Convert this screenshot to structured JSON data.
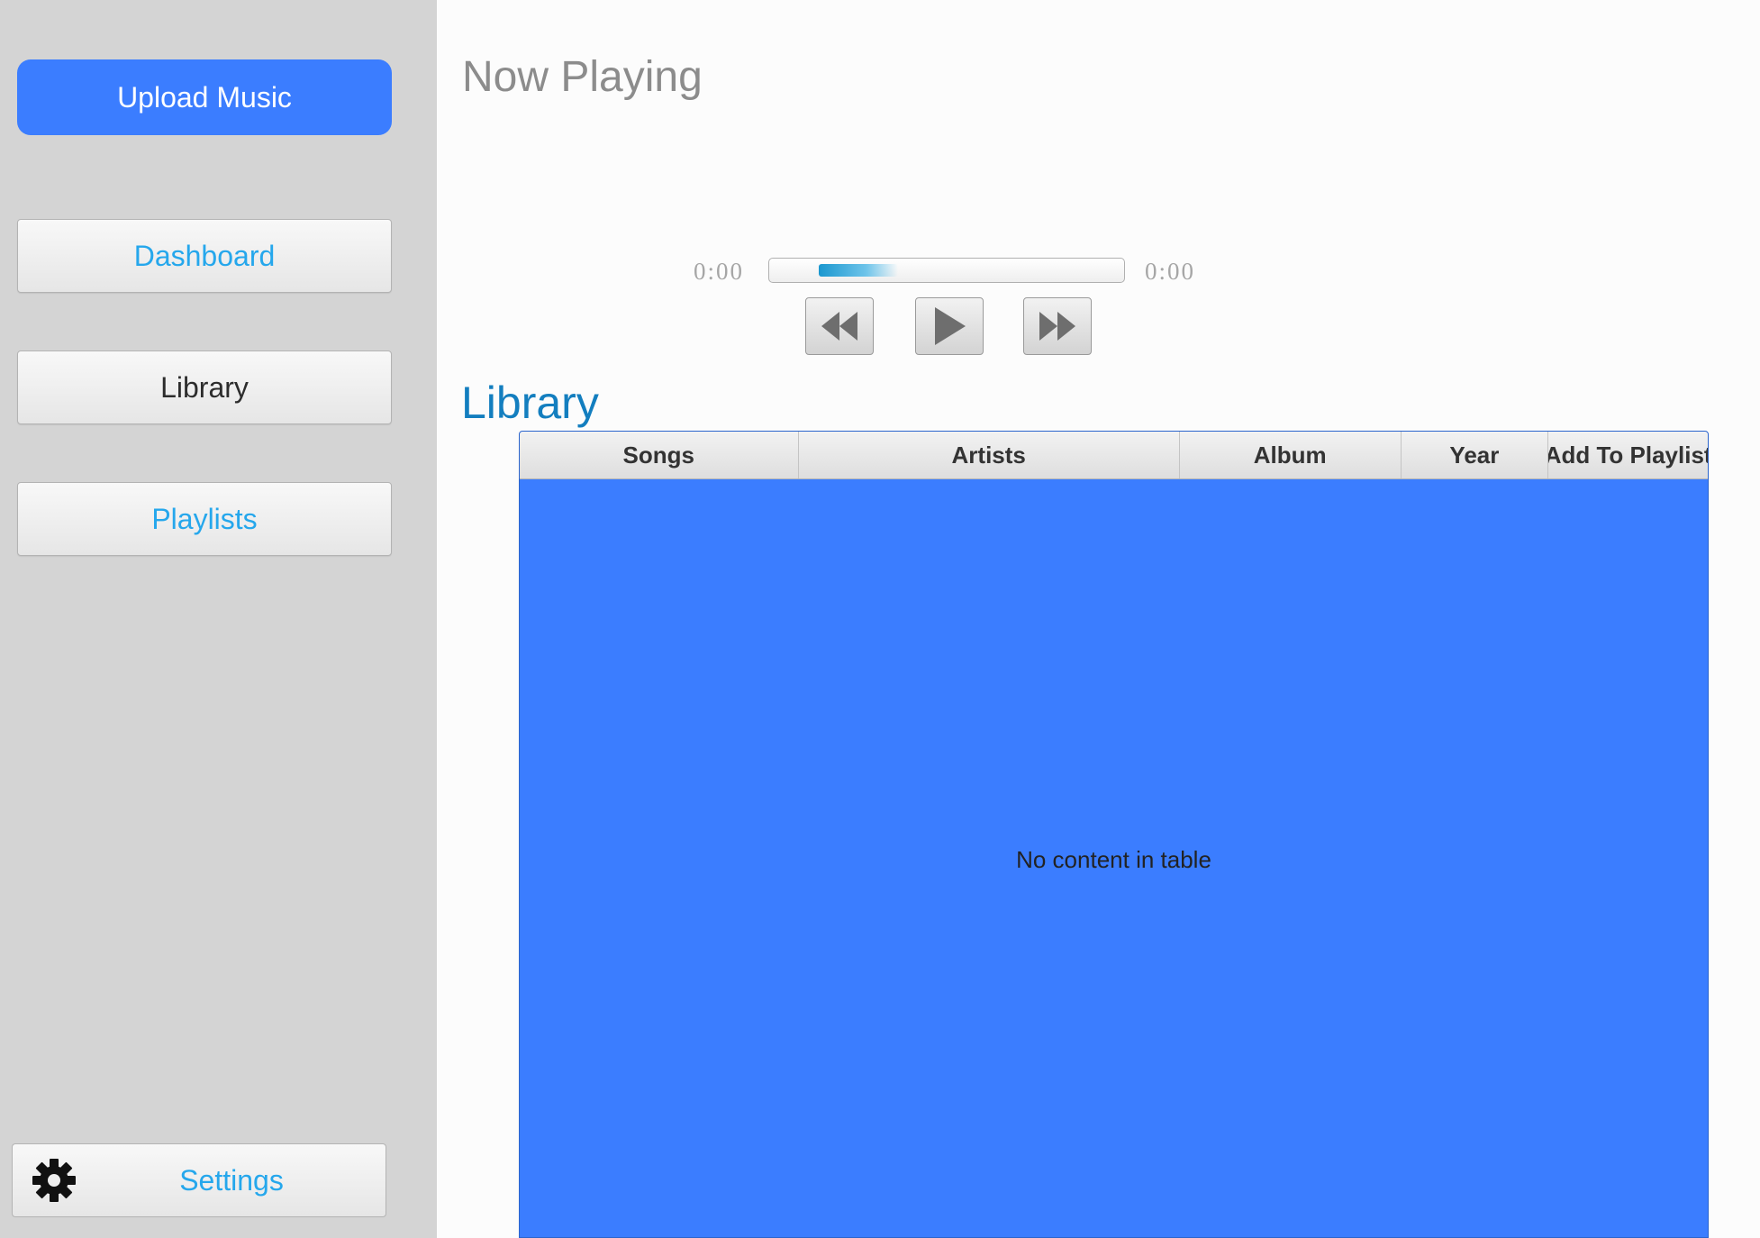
{
  "sidebar": {
    "upload_label": "Upload Music",
    "nav": {
      "dashboard": "Dashboard",
      "library": "Library",
      "playlists": "Playlists"
    },
    "active_item": "Library",
    "settings_label": "Settings"
  },
  "now_playing": {
    "title": "Now Playing",
    "elapsed": "0:00",
    "total": "0:00",
    "progress_indicator_fraction": 0.22,
    "controls": [
      "rewind-icon",
      "play-icon",
      "fast-forward-icon"
    ]
  },
  "library": {
    "title": "Library",
    "columns": [
      "Songs",
      "Artists",
      "Album",
      "Year",
      "Add To Playlist"
    ],
    "rows": [],
    "empty_message": "No content in table"
  },
  "colors": {
    "accent": "#3b7dff",
    "link": "#25a7ec",
    "library_heading": "#137ebf",
    "sidebar_bg": "#d4d4d4"
  }
}
